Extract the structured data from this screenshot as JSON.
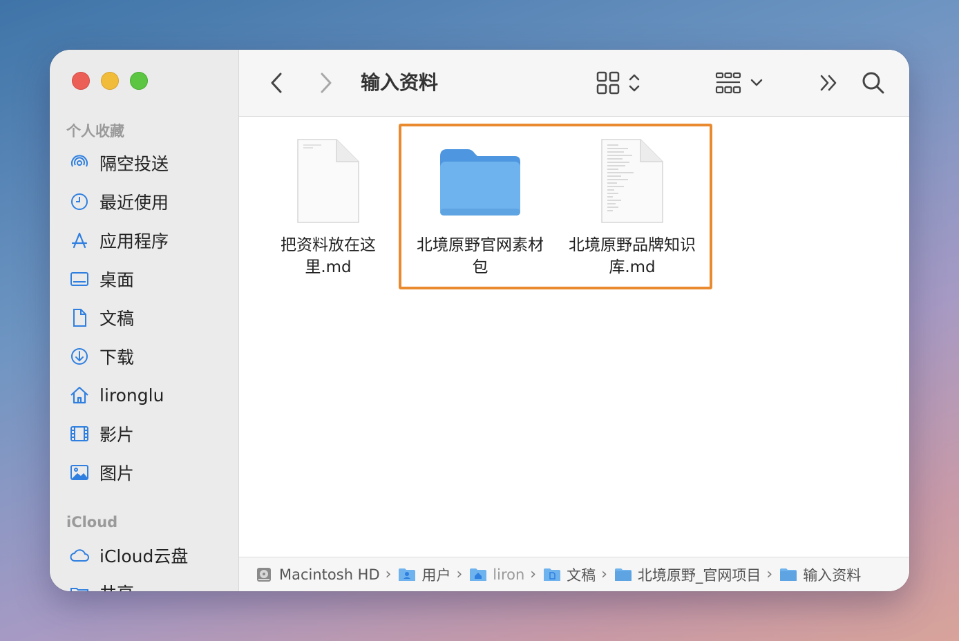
{
  "window": {
    "title": "输入资料"
  },
  "sidebar": {
    "favorites_title": "个人收藏",
    "items": [
      {
        "label": "隔空投送",
        "icon": "airdrop-icon"
      },
      {
        "label": "最近使用",
        "icon": "clock-icon"
      },
      {
        "label": "应用程序",
        "icon": "applications-icon"
      },
      {
        "label": "桌面",
        "icon": "desktop-icon"
      },
      {
        "label": "文稿",
        "icon": "document-icon"
      },
      {
        "label": "下载",
        "icon": "download-icon"
      },
      {
        "label": "lironglu",
        "icon": "home-icon"
      },
      {
        "label": "影片",
        "icon": "film-icon"
      },
      {
        "label": "图片",
        "icon": "photo-icon"
      }
    ],
    "icloud_title": "iCloud",
    "icloud_items": [
      {
        "label": "iCloud云盘",
        "icon": "cloud-icon"
      },
      {
        "label": "共享",
        "icon": "shared-folder-icon"
      }
    ]
  },
  "toolbar": {
    "back_icon": "chevron-left-icon",
    "forward_icon": "chevron-right-icon",
    "view_icon": "grid-view-icon",
    "group_icon": "group-by-icon",
    "more_icon": "double-chevron-icon",
    "search_icon": "search-icon"
  },
  "files": [
    {
      "name": "把资料放在这里.md",
      "type": "text-file"
    },
    {
      "name": "北境原野官网素材包",
      "type": "folder"
    },
    {
      "name": "北境原野品牌知识库.md",
      "type": "text-file"
    }
  ],
  "pathbar": {
    "crumbs": [
      {
        "label": "Macintosh HD",
        "icon": "disk-icon"
      },
      {
        "label": "用户",
        "icon": "users-folder-icon"
      },
      {
        "label": "liron",
        "icon": "home-folder-icon"
      },
      {
        "label": "文稿",
        "icon": "documents-folder-icon"
      },
      {
        "label": "北境原野_官网项目",
        "icon": "folder-icon"
      },
      {
        "label": "输入资料",
        "icon": "folder-icon"
      }
    ]
  },
  "colors": {
    "highlight": "#e98a2e",
    "accent": "#2f7fe0",
    "folder": "#6fb3ee"
  }
}
